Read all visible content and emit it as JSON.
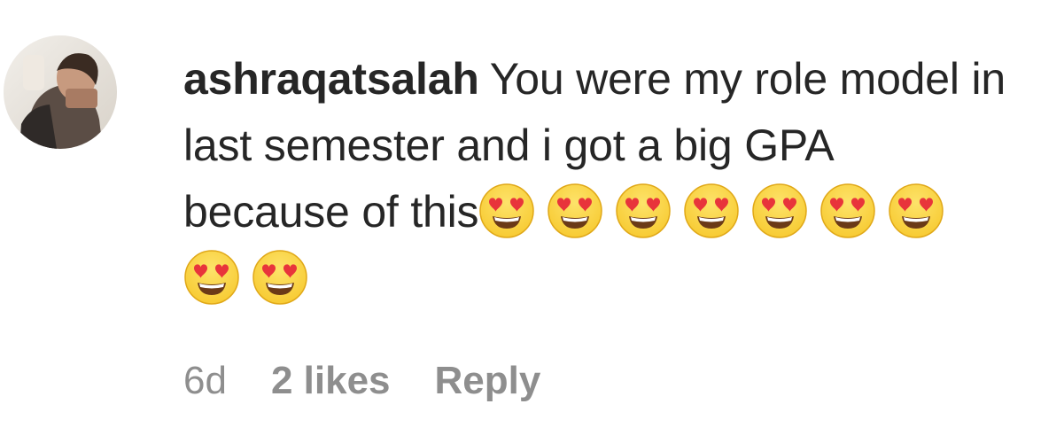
{
  "comment": {
    "username": "ashraqatsalah",
    "text_line": "You were my role model in last semester and i got a big GPA because of this",
    "emoji_count": 9,
    "emoji_icon": "smiling-face-with-heart-eyes-icon",
    "age": "6d",
    "likes": "2 likes",
    "reply_label": "Reply"
  },
  "colors": {
    "text": "#262626",
    "meta": "#8e8e8e",
    "emoji_face": "#f7c92f",
    "emoji_heart": "#e8343b"
  }
}
